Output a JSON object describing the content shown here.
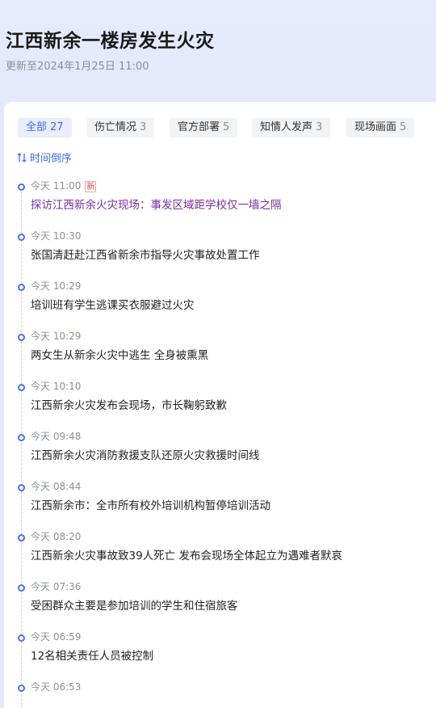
{
  "header": {
    "title": "江西新余一楼房发生火灾",
    "updated": "更新至2024年1月25日 11:00"
  },
  "tabs": [
    {
      "label": "全部",
      "count": "27",
      "active": true
    },
    {
      "label": "伤亡情况",
      "count": "3",
      "active": false
    },
    {
      "label": "官方部署",
      "count": "5",
      "active": false
    },
    {
      "label": "知情人发声",
      "count": "3",
      "active": false
    },
    {
      "label": "现场画面",
      "count": "5",
      "active": false
    }
  ],
  "sort": {
    "label": "时间倒序",
    "icon": "sort-icon"
  },
  "timeline": [
    {
      "time": "今天 11:00",
      "badge": "新",
      "headline": "探访江西新余火灾现场：事发区域距学校仅一墙之隔",
      "visited": true
    },
    {
      "time": "今天 10:30",
      "badge": "",
      "headline": "张国清赶赴江西省新余市指导火灾事故处置工作",
      "visited": false
    },
    {
      "time": "今天 10:29",
      "badge": "",
      "headline": "培训班有学生逃课买衣服避过火灾",
      "visited": false
    },
    {
      "time": "今天 10:29",
      "badge": "",
      "headline": "两女生从新余火灾中逃生 全身被熏黑",
      "visited": false
    },
    {
      "time": "今天 10:10",
      "badge": "",
      "headline": "江西新余火灾发布会现场，市长鞠躬致歉",
      "visited": false
    },
    {
      "time": "今天 09:48",
      "badge": "",
      "headline": "江西新余火灾消防救援支队还原火灾救援时间线",
      "visited": false
    },
    {
      "time": "今天 08:44",
      "badge": "",
      "headline": "江西新余市：全市所有校外培训机构暂停培训活动",
      "visited": false
    },
    {
      "time": "今天 08:20",
      "badge": "",
      "headline": "江西新余火灾事故致39人死亡 发布会现场全体起立为遇难者默哀",
      "visited": false
    },
    {
      "time": "今天 07:36",
      "badge": "",
      "headline": "受困群众主要是参加培训的学生和住宿旅客",
      "visited": false
    },
    {
      "time": "今天 06:59",
      "badge": "",
      "headline": "12名相关责任人员被控制",
      "visited": false
    },
    {
      "time": "今天 06:53",
      "badge": "",
      "headline": "",
      "visited": false
    }
  ],
  "colors": {
    "accent": "#3d6af0",
    "visited": "#7a2fa0",
    "badge": "#e8433e"
  }
}
